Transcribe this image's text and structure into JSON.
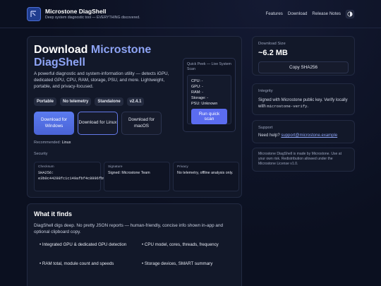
{
  "header": {
    "app_name": "Microstone DiagShell",
    "tagline": "Deep system diagnostic tool — EVERYTHING discovered.",
    "nav": [
      "Features",
      "Download",
      "Release Notes"
    ],
    "theme_icon": "half-moon-icon"
  },
  "hero": {
    "title_plain": "Download ",
    "title_accent": "Microstone DiagShell",
    "description": "A powerful diagnostic and system-information utility — detects iGPU, dedicated GPU, CPU, RAM, storage, PSU, and more. Lightweight, portable, and privacy-focused.",
    "pills": [
      "Portable",
      "No telemetry",
      "Standalone",
      "v2.4.1"
    ],
    "downloads": [
      "Download for Windows",
      "Download for Linux",
      "Download for macOS"
    ],
    "recommended_label": "Recommended:",
    "recommended_value": "Linux",
    "security_label": "Security",
    "security": {
      "checksum_key": "Checksum",
      "checksum_value": "SHA256: e3b0c44298fc1c149afbf4c8996fb924...",
      "signature_key": "Signature",
      "signature_value": "Signed: Microstone Team",
      "privacy_key": "Privacy",
      "privacy_value": "No telemetry, offline analysis only."
    }
  },
  "quick_peek": {
    "title": "Quick Peek — Live System Scan",
    "items": [
      "CPU: -",
      "GPU: -",
      "RAM: -",
      "Storage: -",
      "PSU: Unknown"
    ],
    "button": "Run quick scan"
  },
  "side": {
    "size_label": "Download Size",
    "size_value": "~6.2 MB",
    "copy_button": "Copy SHA256",
    "integrity_label": "Integrity",
    "integrity_text": "Signed with Microstone public key. Verify locally with",
    "integrity_code": "microstone-verify",
    "integrity_end": ".",
    "support_label": "Support",
    "support_text": "Need help?",
    "support_email": "support@microstone.example",
    "license_text": "Microstone DiagShell is made by Microstone. Use at your own risk. Redistribution allowed under the Microstone License v1.0."
  },
  "finds": {
    "title": "What it finds",
    "description": "DiagShell digs deep. No pretty JSON reports — human-friendly, concise info shown in-app and optional clipboard copy.",
    "features": [
      "• Integrated GPU & dedicated GPU detection",
      "• CPU model, cores, threads, frequency",
      "• RAM total, module count and speeds",
      "• Storage devices, SMART summary"
    ]
  },
  "colors": {
    "accent": "#8ea4f5",
    "primary_button": "#5b7bf0",
    "background": "#0b1020"
  }
}
